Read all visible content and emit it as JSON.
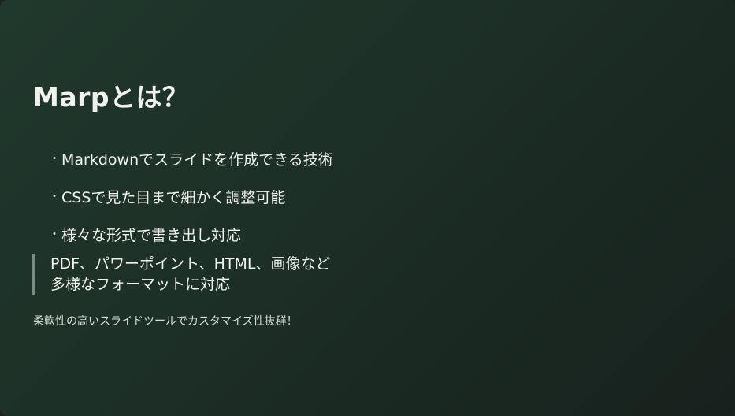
{
  "slide": {
    "title": "Marpとは？",
    "bullet_marker": "・",
    "bullets": [
      "Markdownでスライドを作成できる技術",
      "CSSで見た目まで細かく調整可能",
      "様々な形式で書き出し対応"
    ],
    "quote_lines": [
      "PDF、パワーポイント、HTML、画像など",
      "多様なフォーマットに対応"
    ],
    "footnote": "柔軟性の高いスライドツールでカスタマイズ性抜群！"
  },
  "colors": {
    "background_start": "#20382d",
    "background_end": "#17211d",
    "text": "#f1f1ef",
    "quote_bar": "#7f8a84"
  }
}
